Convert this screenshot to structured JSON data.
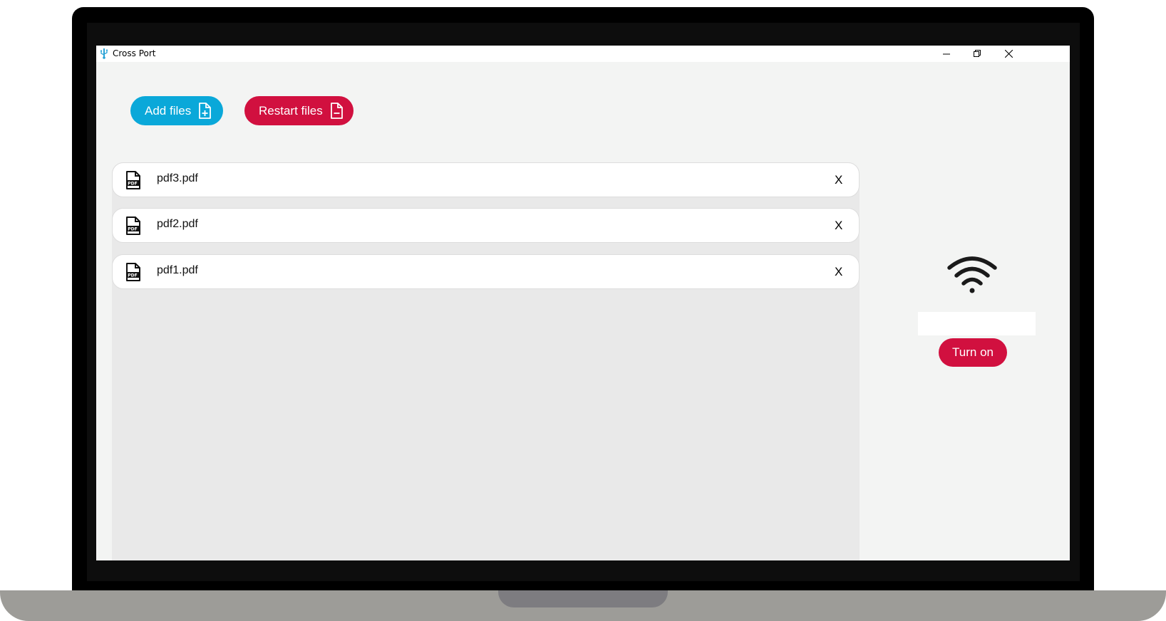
{
  "window": {
    "title": "Cross Port",
    "controls": [
      "minimize",
      "restore",
      "close"
    ]
  },
  "toolbar": {
    "add_label": "Add files",
    "restart_label": "Restart files",
    "add_color": "#0aa8d9",
    "restart_color": "#d1103f"
  },
  "files": [
    {
      "name": "pdf3.pdf",
      "remove": "X"
    },
    {
      "name": "pdf2.pdf",
      "remove": "X"
    },
    {
      "name": "pdf1.pdf",
      "remove": "X"
    }
  ],
  "connection": {
    "icon": "wifi-icon",
    "status_value": "",
    "toggle_label": "Turn on"
  }
}
